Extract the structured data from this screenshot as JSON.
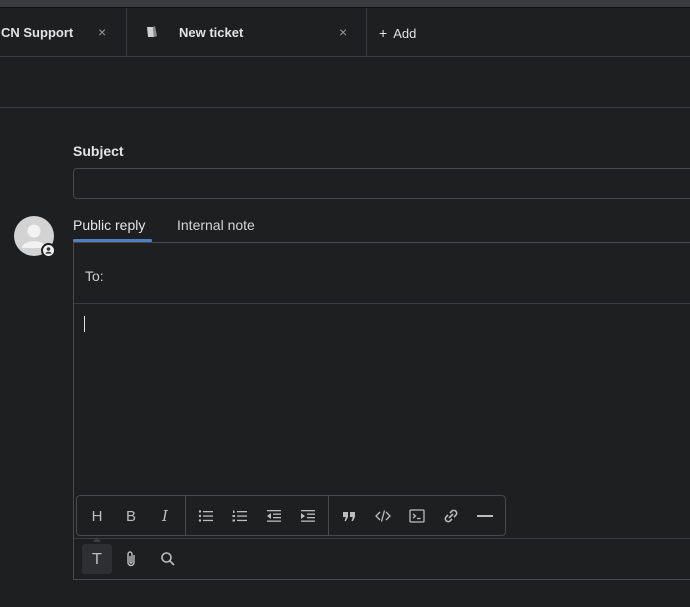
{
  "tabs": [
    {
      "label": "CN Support",
      "close": "×"
    },
    {
      "label": "New ticket",
      "close": "×"
    }
  ],
  "add_tab": {
    "label": "Add",
    "icon": "plus-icon"
  },
  "form": {
    "subject_label": "Subject",
    "subject_value": "",
    "reply_tabs": {
      "public": "Public reply",
      "internal": "Internal note",
      "active": "public"
    },
    "to_label": "To:",
    "body": ""
  },
  "toolbar": {
    "heading": "H",
    "bold": "B",
    "italic": "I",
    "text_format": "T"
  },
  "colors": {
    "accent": "#4f7fc1",
    "background": "#1e1f21",
    "border": "#48494c"
  }
}
